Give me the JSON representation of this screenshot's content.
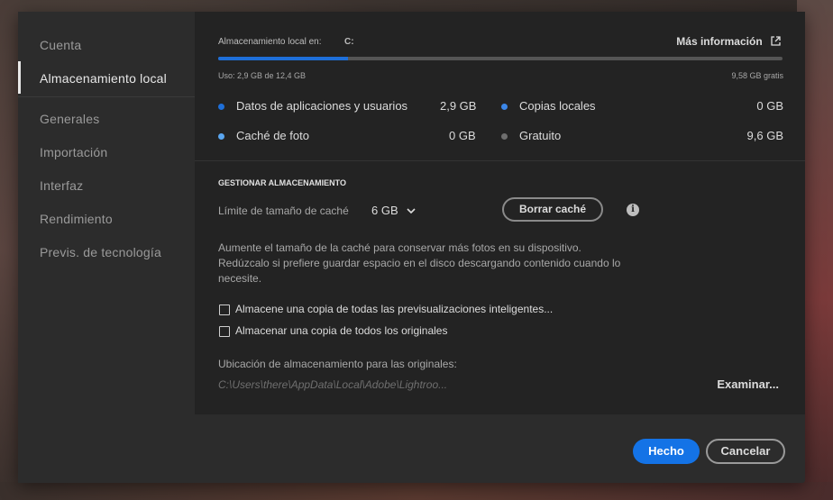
{
  "sidebar": {
    "items": [
      {
        "label": "Cuenta"
      },
      {
        "label": "Almacenamiento local"
      },
      {
        "label": "Generales"
      },
      {
        "label": "Importación"
      },
      {
        "label": "Interfaz"
      },
      {
        "label": "Rendimiento"
      },
      {
        "label": "Previs. de tecnología"
      }
    ],
    "active_index": 1
  },
  "storage": {
    "location_label": "Almacenamiento local en:",
    "drive": "C:",
    "more_info_label": "Más información",
    "usage_text": "Uso: 2,9 GB de 12,4 GB",
    "free_text": "9,58 GB gratis",
    "used_fraction": 0.23,
    "bar_color": "#1e6fd9"
  },
  "legend": [
    {
      "label": "Datos de aplicaciones y usuarios",
      "value": "2,9 GB",
      "color": "#1e6fd9"
    },
    {
      "label": "Caché de foto",
      "value": "0 GB",
      "color": "#5aa6f0"
    },
    {
      "label": "Copias locales",
      "value": "0 GB",
      "color": "#3b86e8"
    },
    {
      "label": "Gratuito",
      "value": "9,6 GB",
      "color": "#6e6e6e"
    }
  ],
  "manage": {
    "heading": "GESTIONAR ALMACENAMIENTO",
    "cache_limit_label": "Límite de tamaño de caché",
    "cache_limit_value": "6 GB",
    "clear_cache_label": "Borrar caché",
    "info_icon": "info-icon",
    "description_line1": "Aumente el tamaño de la caché para conservar más fotos en su dispositivo.",
    "description_line2": "Redúzcalo si prefiere guardar espacio en el disco descargando contenido cuando lo",
    "description_line3": "necesite.",
    "checkbox_previews": "Almacene una copia de todas las previsualizaciones inteligentes...",
    "checkbox_originals": "Almacenar una copia de todos los originales",
    "originals_location_label": "Ubicación de almacenamiento para las originales:",
    "originals_path": "C:\\Users\\there\\AppData\\Local\\Adobe\\Lightroo...",
    "browse_label": "Examinar..."
  },
  "footer": {
    "done_label": "Hecho",
    "cancel_label": "Cancelar",
    "primary_color": "#1473e6"
  }
}
